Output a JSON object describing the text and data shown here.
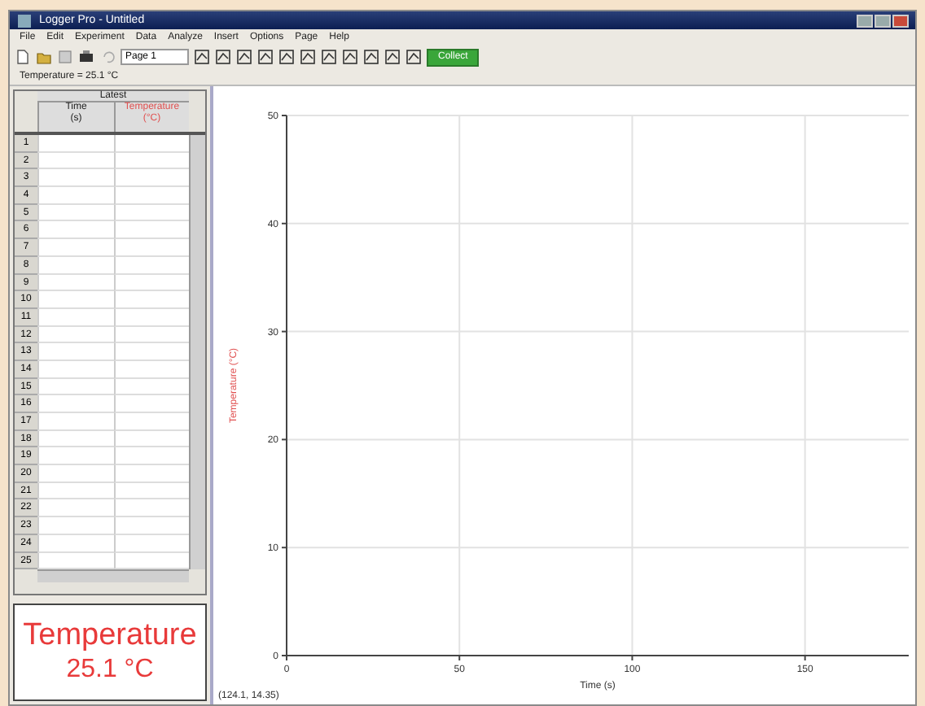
{
  "window": {
    "title": "Logger Pro - Untitled"
  },
  "menu": [
    "File",
    "Edit",
    "Experiment",
    "Data",
    "Analyze",
    "Insert",
    "Options",
    "Page",
    "Help"
  ],
  "toolbar": {
    "page_select": "Page 1",
    "collect_button": "Collect"
  },
  "sensor_readout": "Temperature = 25.1 °C",
  "table": {
    "group": "Latest",
    "columns": [
      {
        "name": "Time",
        "unit": "(s)",
        "color": "#222222"
      },
      {
        "name": "Temperature",
        "unit": "(°C)",
        "color": "#e05050"
      }
    ],
    "rows": [
      "1",
      "2",
      "3",
      "4",
      "5",
      "6",
      "7",
      "8",
      "9",
      "10",
      "11",
      "12",
      "13",
      "14",
      "15",
      "16",
      "17",
      "18",
      "19",
      "20",
      "21",
      "22",
      "23",
      "24",
      "25"
    ]
  },
  "meter": {
    "label": "Temperature",
    "value": "25.1 °C"
  },
  "graph": {
    "chart_data": {
      "type": "line",
      "xlabel": "Time (s)",
      "ylabel": "Temperature (°C)",
      "xlim": [
        0,
        180
      ],
      "ylim": [
        0,
        50
      ],
      "xticks": [
        0,
        50,
        100,
        150
      ],
      "yticks": [
        0,
        10,
        20,
        30,
        40,
        50
      ],
      "grid": true
    },
    "status": "(124.1, 14.35)"
  }
}
